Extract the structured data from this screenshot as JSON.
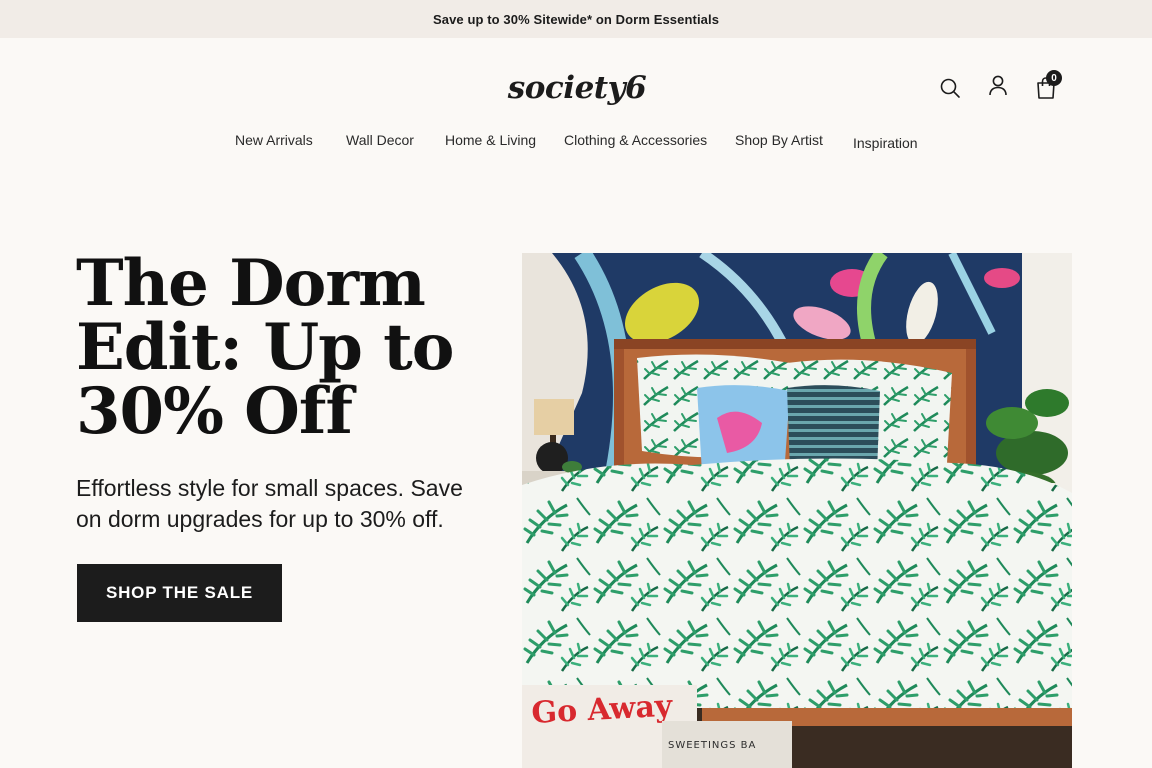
{
  "promo": {
    "text": "Save up to 30% Sitewide* on Dorm Essentials"
  },
  "brand": {
    "logo": "society6"
  },
  "header": {
    "icons": [
      "search-icon",
      "account-icon",
      "cart-icon"
    ],
    "cart_count": "0"
  },
  "nav": {
    "items": [
      "New Arrivals",
      "Wall Decor",
      "Home & Living",
      "Clothing & Accessories",
      "Shop By Artist",
      "Inspiration"
    ]
  },
  "hero": {
    "title": "The Dorm Edit: Up to 30% Off",
    "subtitle": "Effortless style for small spaces. Save on dorm upgrades for up to 30% off.",
    "cta": "SHOP THE SALE",
    "image_sign_text": "Go Away",
    "image_book_text": "SWEETINGS BA"
  },
  "colors": {
    "accent": "#1c1c1c",
    "background": "#fbf9f6",
    "promo_bg": "#f1ece7",
    "wall": "#1f3a66",
    "leaf_green": "#1f8a5a"
  }
}
